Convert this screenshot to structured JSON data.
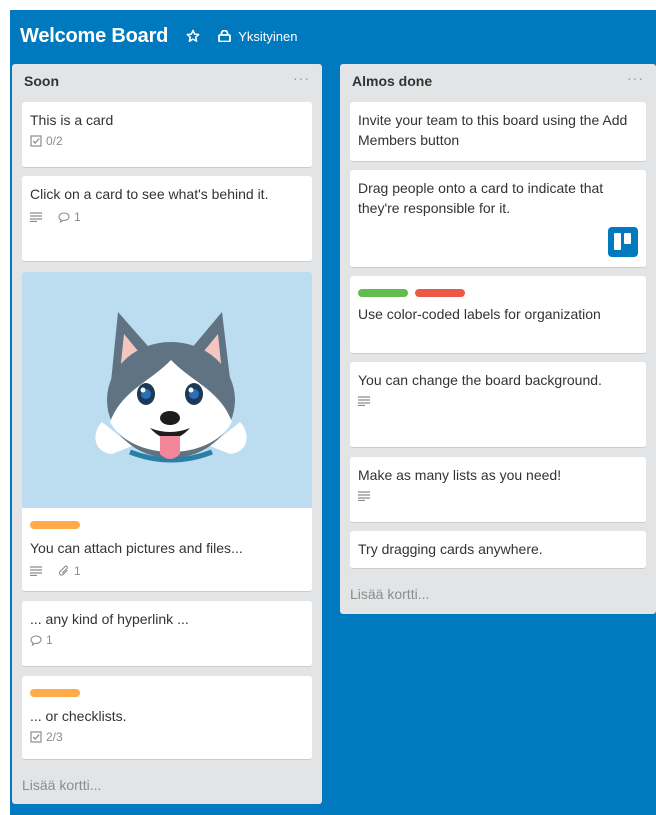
{
  "board": {
    "title": "Welcome Board",
    "visibility": "Yksityinen",
    "background_color": "#0079bf"
  },
  "lists": [
    {
      "title": "Soon",
      "menu": "···",
      "add_card": "Lisää kortti...",
      "cards": [
        {
          "text": "This is a card",
          "checklist": "0/2"
        },
        {
          "text": "Click on a card to see what's behind it.",
          "comments": "1"
        },
        {
          "text": "You can attach pictures and files...",
          "attachments": "1",
          "label_color": "#ffab4a",
          "cover": "husky"
        },
        {
          "text": "... any kind of hyperlink ...",
          "comments": "1"
        },
        {
          "text": "... or checklists.",
          "checklist": "2/3",
          "label_color": "#ffab4a"
        }
      ]
    },
    {
      "title": "Almos done",
      "menu": "···",
      "add_card": "Lisää kortti...",
      "cards": [
        {
          "text": "Invite your team to this board using the Add Members button"
        },
        {
          "text": "Drag people onto a card to indicate that they're responsible for it."
        },
        {
          "text": "Use color-coded labels for organization",
          "labels": [
            "#61bd4f",
            "#eb5a46"
          ]
        },
        {
          "text": "You can change the board background."
        },
        {
          "text": "Make as many lists as you need!"
        },
        {
          "text": "Try dragging cards anywhere."
        }
      ]
    }
  ]
}
